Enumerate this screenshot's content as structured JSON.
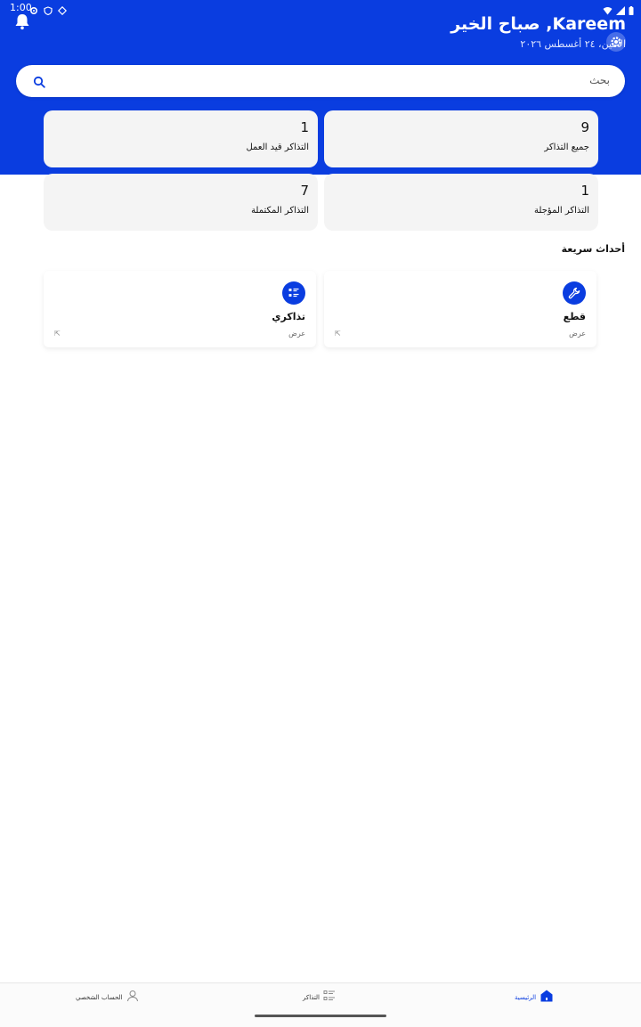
{
  "status_bar": {
    "time": "1:00"
  },
  "header": {
    "greeting": "صباح الخير ,Kareem",
    "date": "الاثنين، ٢٤ أغسطس ٢٠٢٦"
  },
  "search": {
    "placeholder": "بحث"
  },
  "stats": [
    {
      "value": "9",
      "label": "جميع التذاكر"
    },
    {
      "value": "1",
      "label": "التذاكر قيد العمل"
    },
    {
      "value": "1",
      "label": "التذاكر المؤجلة"
    },
    {
      "value": "7",
      "label": "التذاكر المكتملة"
    }
  ],
  "quick_actions": {
    "title": "أحداث سريعة",
    "items": [
      {
        "title": "قطع",
        "subtitle": "عرض",
        "icon": "wrench-icon"
      },
      {
        "title": "تذاكري",
        "subtitle": "عرض",
        "icon": "list-icon"
      }
    ]
  },
  "bottom_nav": {
    "items": [
      {
        "label": "الرئيسية",
        "icon": "home-icon",
        "active": true
      },
      {
        "label": "التذاكر",
        "icon": "tickets-icon",
        "active": false
      },
      {
        "label": "الحساب الشخصي",
        "icon": "profile-icon",
        "active": false
      }
    ]
  },
  "colors": {
    "primary": "#0a3de0",
    "card_bg": "#f4f4f4",
    "page_bg": "#ffffff"
  }
}
